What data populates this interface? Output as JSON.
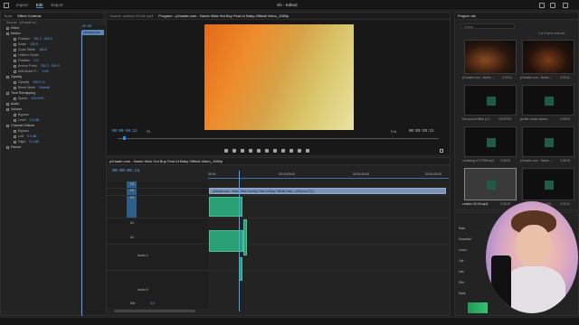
{
  "app": {
    "menu": [
      "Import",
      "Edit",
      "Export"
    ],
    "active_menu": "Edit",
    "title": "sfx - Edited"
  },
  "left_panel": {
    "tabs": [
      "Tools",
      "Effect Controls"
    ],
    "active_tab": "Effect Controls",
    "source_label": "Source · p2made.co...",
    "rows": [
      {
        "label": "Video",
        "kind": "hdr"
      },
      {
        "label": "Motion",
        "kind": "hdr"
      },
      {
        "label": "Position",
        "v1": "781.3",
        "v2": "540.0"
      },
      {
        "label": "Scale",
        "v1": "100.0"
      },
      {
        "label": "Scale Width",
        "v1": "100.0"
      },
      {
        "label": "Uniform Scale"
      },
      {
        "label": "Rotation",
        "v1": "0.0"
      },
      {
        "label": "Anchor Point",
        "v1": "781.3",
        "v2": "540.0"
      },
      {
        "label": "Anti-flicker F...",
        "v1": "0.00"
      },
      {
        "label": "Opacity",
        "kind": "hdr"
      },
      {
        "label": "Opacity",
        "v1": "100.0 %"
      },
      {
        "label": "Blend Mode",
        "v1": "Normal"
      },
      {
        "label": "Time Remapping",
        "kind": "hdr"
      },
      {
        "label": "Speed",
        "v1": "100.00%"
      },
      {
        "label": "Audio",
        "kind": "hdr"
      },
      {
        "label": "Volume",
        "kind": "hdr"
      },
      {
        "label": "Bypass"
      },
      {
        "label": "Level",
        "v1": "0.0 dB"
      },
      {
        "label": "Channel Volume",
        "kind": "hdr"
      },
      {
        "label": "Bypass"
      },
      {
        "label": "Left",
        "v1": "0.0 dB"
      },
      {
        "label": "Right",
        "v1": "0.0 dB"
      },
      {
        "label": "Panner",
        "kind": "hdr"
      }
    ],
    "mini_time": "00:00",
    "mini_clip": "p2made.com"
  },
  "source_tab": "Source: contrex 00-04.mp3",
  "program_tab": "Program - p2made.com - Nardo Wick  Hot Boy Feat Lil Baby Official Video_1080p",
  "monitor": {
    "timecode_left": "00:00:06:12",
    "fit": "Fit",
    "quality": "Full",
    "timecode_right": "00:03:03:11"
  },
  "timeline": {
    "tab": "p2made.com - Nardo Wick  Hot Boy Feat Lil Baby Official Video_1080p",
    "timecode": "00:00:06:12",
    "ruler": [
      "00:00",
      "00:00:05:00",
      "00:00:10:00",
      "00:00:15:00"
    ],
    "video_clip": "p2made.com - Nardo Wick  Hot Boy Feat Lil Baby Official Video_1080p.mp4 [V]",
    "tracks": [
      "V3",
      "V2",
      "V1",
      "A1",
      "A2",
      "A3",
      "A4",
      "A5",
      "A6",
      "Mix"
    ],
    "track_names": {
      "a4": "Audio 4",
      "a5": "Audio 5"
    },
    "mix_value": "0.0"
  },
  "project": {
    "tab": "Project: sfx",
    "search_placeholder": "Search",
    "count": "1 of 6 items selected",
    "items": [
      {
        "name": "p2made.com - Nardo ...",
        "dur": "3:03:11"
      },
      {
        "name": "p2made.com - Nardo ...",
        "dur": "3:03:11"
      },
      {
        "name": "fire sound effect (LX...",
        "dur": "15:09790"
      },
      {
        "name": "gentle ocean waves...",
        "dur": "3:05:10"
      },
      {
        "name": "mudsong-4-07059.mp3",
        "dur": "3:05:19"
      },
      {
        "name": "p2made.com - Nardo ...",
        "dur": "3:46:19"
      },
      {
        "name": "contrex 00-04.mp3",
        "dur": "3:05:19"
      },
      {
        "name": "whoosh_long_low-009...",
        "dur": "3:03:11"
      }
    ]
  },
  "side_tools": [
    "Rate",
    "Essential",
    "Learn",
    "Libr",
    "Info",
    "Effe",
    "Mark"
  ],
  "colors": {
    "accent": "#2d8ceb",
    "timecode": "#5fb0ff",
    "audio_clip": "#2aa174",
    "video_clip": "#7c93b6"
  }
}
